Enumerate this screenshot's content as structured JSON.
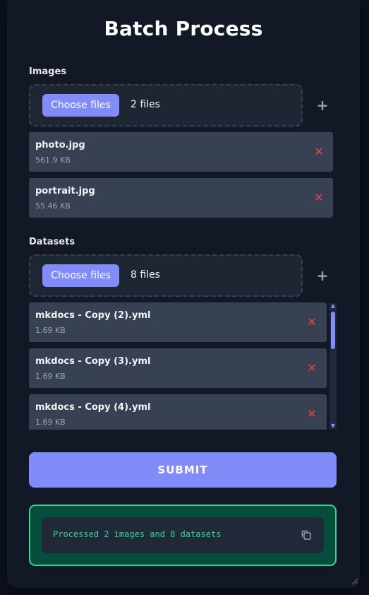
{
  "header": {
    "title": "Batch Process"
  },
  "images": {
    "label": "Images",
    "choose_label": "Choose files",
    "count_text": "2 files",
    "files": [
      {
        "name": "photo.jpg",
        "size": "561.9 KB"
      },
      {
        "name": "portrait.jpg",
        "size": "55.46 KB"
      }
    ]
  },
  "datasets": {
    "label": "Datasets",
    "choose_label": "Choose files",
    "count_text": "8 files",
    "files": [
      {
        "name": "mkdocs - Copy (2).yml",
        "size": "1.69 KB"
      },
      {
        "name": "mkdocs - Copy (3).yml",
        "size": "1.69 KB"
      },
      {
        "name": "mkdocs - Copy (4).yml",
        "size": "1.69 KB"
      }
    ]
  },
  "submit_label": "SUBMIT",
  "result": {
    "text": "Processed 2 images and 8 datasets"
  },
  "icons": {
    "add": "plus-icon",
    "remove": "close-icon",
    "copy": "copy-icon"
  },
  "colors": {
    "accent": "#818cf8",
    "danger": "#ef4444",
    "success": "#34d399",
    "success_bg": "#064e3b",
    "card_bg": "#121826"
  }
}
